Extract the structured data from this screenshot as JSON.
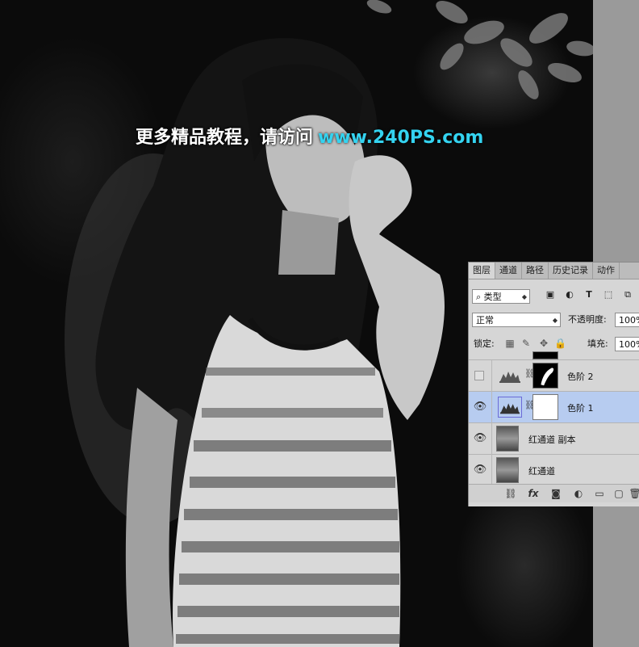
{
  "watermark": {
    "text_cn": "更多精品教程，请访问",
    "url": "www.240PS.com"
  },
  "layers_panel": {
    "tabs": [
      {
        "label": "图层",
        "active": true
      },
      {
        "label": "通道",
        "active": false
      },
      {
        "label": "路径",
        "active": false
      },
      {
        "label": "历史记录",
        "active": false
      },
      {
        "label": "动作",
        "active": false
      }
    ],
    "filter": {
      "kind": "类型",
      "search_icon": "search-icon",
      "icons": [
        "image-filter-icon",
        "adjustment-filter-icon",
        "type-filter-icon",
        "shape-filter-icon",
        "smart-object-filter-icon"
      ]
    },
    "blend_mode": "正常",
    "opacity_label": "不透明度:",
    "opacity_value": "100%",
    "lock_label": "锁定:",
    "fill_label": "填充:",
    "fill_value": "100%",
    "layers": [
      {
        "name": "色阶 2",
        "visible": false,
        "selected": false,
        "type": "levels-adjustment"
      },
      {
        "name": "色阶 1",
        "visible": true,
        "selected": true,
        "type": "levels-adjustment"
      },
      {
        "name": "红通道 副本",
        "visible": true,
        "selected": false,
        "type": "pixel"
      },
      {
        "name": "红通道",
        "visible": true,
        "selected": false,
        "type": "pixel"
      }
    ],
    "footer_icons": [
      "link-icon",
      "fx-icon",
      "add-mask-icon",
      "new-adjustment-icon",
      "new-group-icon",
      "new-layer-icon",
      "delete-icon"
    ]
  },
  "colors": {
    "selected_layer": "#b7ccf0",
    "watermark_url": "#34d3f0",
    "panel_bg": "#d6d6d6"
  }
}
